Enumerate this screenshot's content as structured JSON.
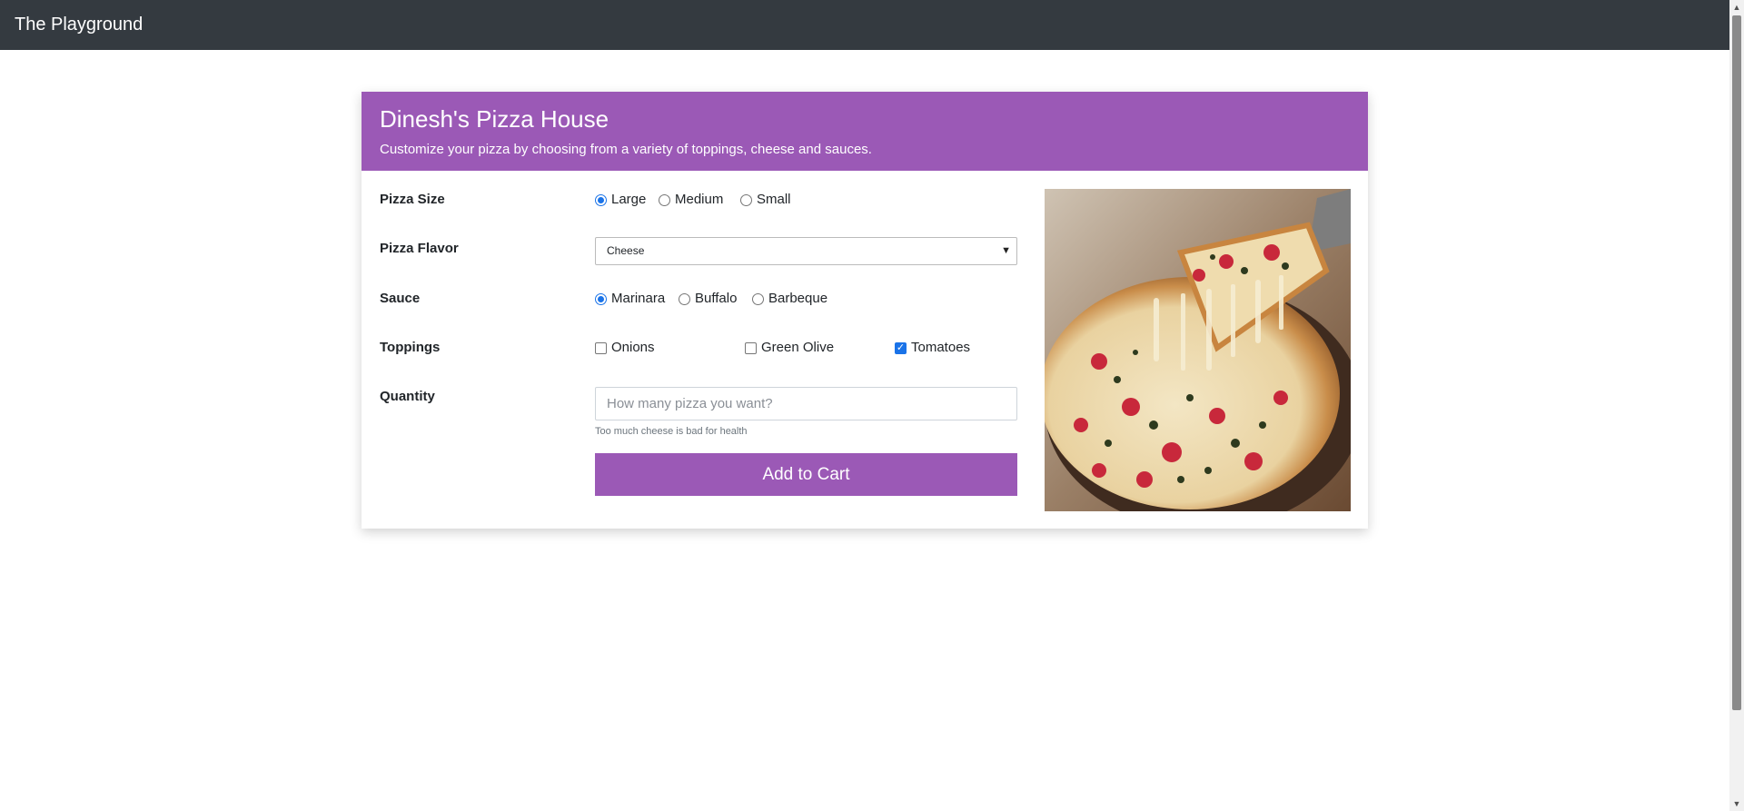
{
  "app": {
    "brand": "The Playground"
  },
  "card": {
    "title": "Dinesh's Pizza House",
    "subtitle": "Customize your pizza by choosing from a variety of toppings, cheese and sauces."
  },
  "form": {
    "size": {
      "label": "Pizza Size",
      "options": [
        {
          "label": "Large",
          "checked": true
        },
        {
          "label": "Medium",
          "checked": false
        },
        {
          "label": "Small",
          "checked": false
        }
      ]
    },
    "flavor": {
      "label": "Pizza Flavor",
      "selected": "Cheese"
    },
    "sauce": {
      "label": "Sauce",
      "options": [
        {
          "label": "Marinara",
          "checked": true
        },
        {
          "label": "Buffalo",
          "checked": false
        },
        {
          "label": "Barbeque",
          "checked": false
        }
      ]
    },
    "toppings": {
      "label": "Toppings",
      "options": [
        {
          "label": "Onions",
          "checked": false
        },
        {
          "label": "Green Olive",
          "checked": false
        },
        {
          "label": "Tomatoes",
          "checked": true
        }
      ]
    },
    "quantity": {
      "label": "Quantity",
      "placeholder": "How many pizza you want?",
      "help": "Too much cheese is bad for health"
    },
    "submit_label": "Add to Cart"
  },
  "colors": {
    "navbar": "#343a40",
    "accent": "#9b59b6",
    "radio_checked": "#1a73e8"
  },
  "icons": {
    "select_arrow": "chevron-down-icon",
    "checkbox_check": "check-icon"
  }
}
